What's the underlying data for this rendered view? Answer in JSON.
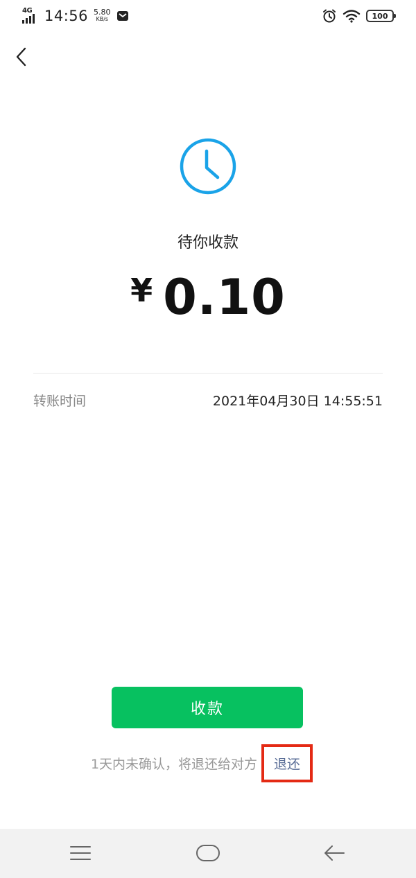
{
  "status_bar": {
    "network": "4G",
    "time": "14:56",
    "speed_value": "5.80",
    "speed_unit": "KB/s",
    "battery": "100"
  },
  "transfer": {
    "status_title": "待你收款",
    "currency": "¥",
    "amount": "0.10",
    "time_label": "转账时间",
    "time_value": "2021年04月30日 14:55:51"
  },
  "actions": {
    "collect_label": "收款",
    "notice_text": "1天内未确认，将退还给对方",
    "refund_label": "退还"
  },
  "colors": {
    "primary_green": "#07c160",
    "clock_blue": "#1aa3e8",
    "link_blue": "#576b95",
    "highlight_red": "#e42a14"
  },
  "icons": {
    "back": "chevron-left-icon",
    "status": "clock-icon",
    "nav_menu": "menu-icon",
    "nav_home": "home-icon",
    "nav_back": "arrow-left-icon"
  }
}
